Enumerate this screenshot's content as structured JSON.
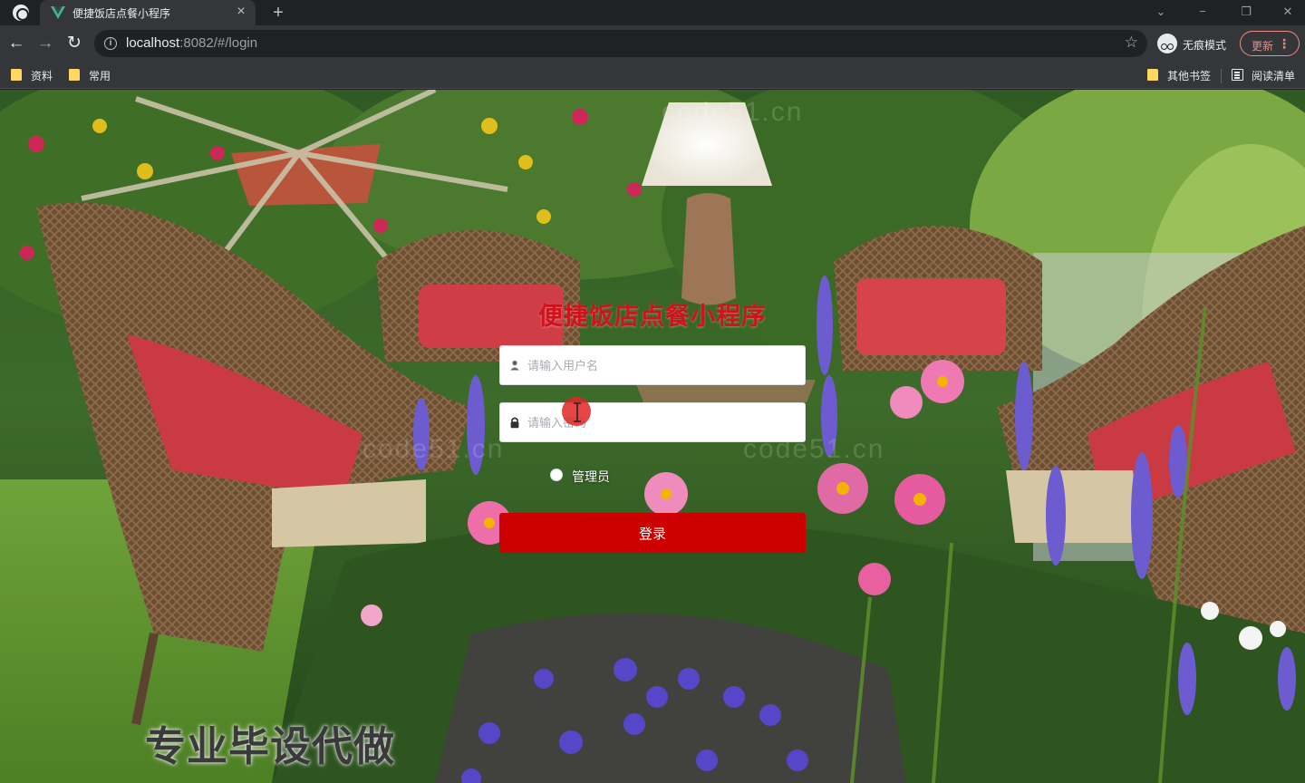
{
  "browser": {
    "tab_title": "便捷饭店点餐小程序",
    "url_host": "localhost",
    "url_rest": ":8082/#/login",
    "incognito_label": "无痕模式",
    "update_label": "更新",
    "bookmarks": [
      "资料",
      "常用"
    ],
    "bookmarks_right": [
      "其他书签",
      "阅读清单"
    ]
  },
  "login": {
    "title": "便捷饭店点餐小程序",
    "username_placeholder": "请输入用户名",
    "password_placeholder": "请输入密码",
    "role_label": "管理员",
    "submit_label": "登录"
  },
  "overlay": {
    "promo_text": "专业毕设代做",
    "watermarks": [
      "code51.cn",
      "code51.cn",
      "code51.cn"
    ]
  },
  "colors": {
    "title_red": "#d0121b",
    "button_red": "#cd0000"
  }
}
